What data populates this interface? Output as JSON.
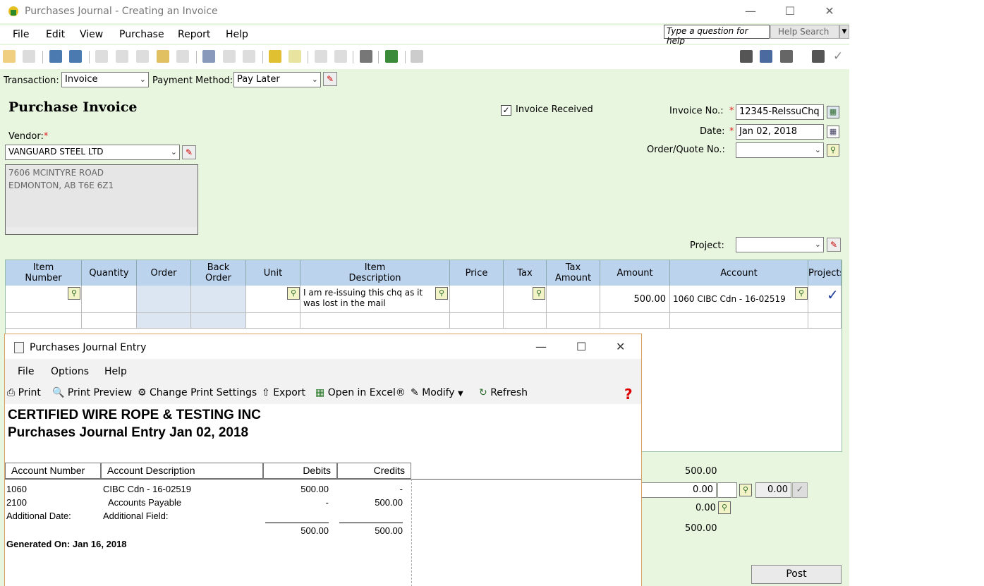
{
  "window": {
    "title": "Purchases Journal - Creating an Invoice"
  },
  "menu": [
    "File",
    "Edit",
    "View",
    "Purchase",
    "Report",
    "Help"
  ],
  "help": {
    "ask_placeholder": "Type a question for help",
    "search_label": "Help Search"
  },
  "transaction": {
    "label": "Transaction:",
    "value": "Invoice"
  },
  "payment": {
    "label": "Payment Method:",
    "value": "Pay Later"
  },
  "invoice": {
    "heading": "Purchase Invoice",
    "received_label": "Invoice Received",
    "received_checked": true,
    "number_label": "Invoice No.:",
    "number": "12345-ReIssuChq",
    "date_label": "Date:",
    "date": "Jan 02, 2018",
    "order_label": "Order/Quote No.:",
    "order": "",
    "project_label": "Project:",
    "project": ""
  },
  "vendor": {
    "label": "Vendor:",
    "name": "VANGUARD STEEL LTD",
    "address_line1": "7606 MCINTYRE ROAD",
    "address_line2": "EDMONTON, AB  T6E 6Z1"
  },
  "grid": {
    "headers": [
      "Item\nNumber",
      "Quantity",
      "Order",
      "Back\nOrder",
      "Unit",
      "Item\nDescription",
      "Price",
      "Tax",
      "Tax\nAmount",
      "Amount",
      "Account",
      "Projects"
    ],
    "row": {
      "description": "I am re-issuing this chq as it was lost in the mail",
      "amount": "500.00",
      "account": "1060 CIBC Cdn - 16-02519"
    }
  },
  "totals": {
    "subtotal": "500.00",
    "freight": "0.00",
    "freight_tax": "0.00",
    "tax": "0.00",
    "total": "500.00"
  },
  "post_label": "Post",
  "journal": {
    "title": "Purchases Journal Entry",
    "menu": [
      "File",
      "Options",
      "Help"
    ],
    "toolbar": [
      "Print",
      "Print Preview",
      "Change Print Settings",
      "Export",
      "Open in Excel®",
      "Modify",
      "Refresh"
    ],
    "company": "CERTIFIED WIRE ROPE & TESTING INC",
    "report_title": "Purchases Journal Entry Jan 02, 2018",
    "columns": [
      "Account Number",
      "Account Description",
      "Debits",
      "Credits"
    ],
    "rows": [
      {
        "number": "1060",
        "description": "CIBC Cdn - 16-02519",
        "debit": "500.00",
        "credit": "-"
      },
      {
        "number": "2100",
        "description": "Accounts Payable",
        "debit": "-",
        "credit": "500.00"
      }
    ],
    "additional_date": "Additional Date:",
    "additional_field": "Additional Field:",
    "total_debit": "500.00",
    "total_credit": "500.00",
    "generated": "Generated On: Jan 16, 2018"
  },
  "colors": {
    "form_bg": "#e9f6df",
    "grid_header": "#bcd3ee",
    "accent": "#d9a060"
  }
}
